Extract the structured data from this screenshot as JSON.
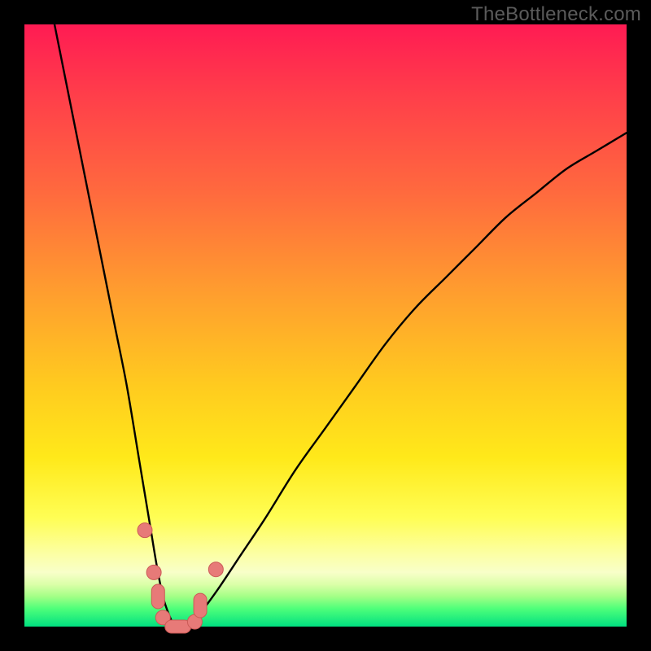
{
  "watermark": "TheBottleneck.com",
  "colors": {
    "frame": "#000000",
    "gradient_top": "#ff1b53",
    "gradient_mid": "#ffe91a",
    "gradient_bottom": "#00e080",
    "curve_stroke": "#000000",
    "marker_fill": "#e77a78",
    "marker_stroke": "#cc5a57"
  },
  "chart_data": {
    "type": "line",
    "title": "",
    "xlabel": "",
    "ylabel": "",
    "xlim": [
      0,
      100
    ],
    "ylim": [
      0,
      100
    ],
    "grid": false,
    "legend": false,
    "series": [
      {
        "name": "bottleneck-curve",
        "x": [
          5,
          7,
          9,
          11,
          13,
          15,
          17,
          19,
          20,
          21,
          22,
          23,
          24,
          25,
          26,
          27,
          29,
          32,
          36,
          40,
          45,
          50,
          55,
          60,
          65,
          70,
          75,
          80,
          85,
          90,
          95,
          100
        ],
        "values": [
          100,
          90,
          80,
          70,
          60,
          50,
          40,
          28,
          22,
          16,
          10,
          5,
          2,
          0,
          0,
          0,
          2,
          6,
          12,
          18,
          26,
          33,
          40,
          47,
          53,
          58,
          63,
          68,
          72,
          76,
          79,
          82
        ]
      }
    ],
    "markers": [
      {
        "x": 20.0,
        "y": 16.0,
        "shape": "circle"
      },
      {
        "x": 21.5,
        "y": 9.0,
        "shape": "circle"
      },
      {
        "x": 22.2,
        "y": 5.0,
        "shape": "pill-v"
      },
      {
        "x": 23.0,
        "y": 1.5,
        "shape": "circle"
      },
      {
        "x": 25.5,
        "y": 0.0,
        "shape": "pill-h"
      },
      {
        "x": 28.3,
        "y": 0.8,
        "shape": "circle"
      },
      {
        "x": 29.2,
        "y": 3.5,
        "shape": "pill-v"
      },
      {
        "x": 31.8,
        "y": 9.5,
        "shape": "circle"
      }
    ]
  }
}
